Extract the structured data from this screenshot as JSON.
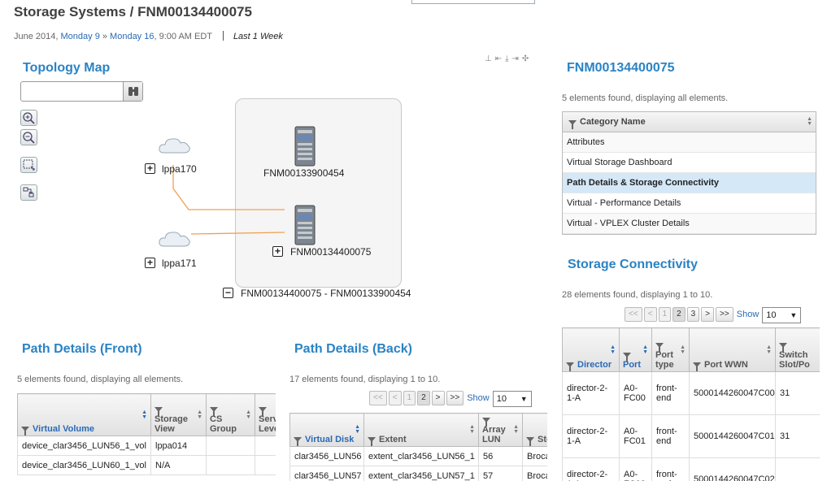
{
  "header": {
    "title": "Storage Systems / FNM00134400075",
    "date_prefix": "June 2014, ",
    "date_from": "Monday 9",
    "date_mid": " » ",
    "date_to": "Monday 16",
    "date_time": ", 9:00 AM EDT",
    "range": "Last 1 Week"
  },
  "topology": {
    "title": "Topology Map",
    "search_placeholder": "",
    "nodes": {
      "host1": "lppa170",
      "host2": "lppa171",
      "storage1": "FNM00133900454",
      "storage2": "FNM00134400075",
      "group": "FNM00134400075 - FNM00133900454"
    },
    "line_color": "#f0a050"
  },
  "categories": {
    "title": "FNM00134400075",
    "found": "5 elements found, displaying all elements.",
    "header": "Category Name",
    "items": [
      "Attributes",
      "Virtual Storage Dashboard",
      "Path Details & Storage Connectivity",
      "Virtual - Performance Details",
      "Virtual - VPLEX Cluster Details"
    ],
    "selected_index": 2
  },
  "connectivity": {
    "title": "Storage Connectivity",
    "found": "28 elements found, displaying 1 to 10.",
    "pager": {
      "first": "<<",
      "prev": "<",
      "pages": [
        "1",
        "2",
        "3"
      ],
      "next": ">",
      "last": ">>",
      "show_label": "Show",
      "show_value": "10"
    },
    "columns": [
      "Director",
      "Port",
      "Port type",
      "Port WWN",
      "Switch Slot/Po"
    ],
    "rows": [
      [
        "director-2-1-A",
        "A0-FC00",
        "front-end",
        "5000144260047C00",
        "31"
      ],
      [
        "director-2-1-A",
        "A0-FC01",
        "front-end",
        "5000144260047C01",
        "31"
      ],
      [
        "director-2-1-A",
        "A0-FC02",
        "front-end",
        "5000144260047C02",
        ""
      ]
    ]
  },
  "front": {
    "title": "Path Details (Front)",
    "found": "5 elements found, displaying all elements.",
    "columns": [
      "Virtual Volume",
      "Storage View",
      "CS Group",
      "Serv Leve"
    ],
    "rows": [
      [
        "device_clar3456_LUN56_1_vol",
        "lppa014",
        "",
        ""
      ],
      [
        "device_clar3456_LUN60_1_vol",
        "N/A",
        "",
        ""
      ]
    ]
  },
  "back": {
    "title": "Path Details (Back)",
    "found": "17 elements found, displaying 1 to 10.",
    "pager": {
      "first": "<<",
      "prev": "<",
      "pages": [
        "1",
        "2"
      ],
      "next": ">",
      "last": ">>",
      "show_label": "Show",
      "show_value": "10"
    },
    "columns": [
      "Virtual Disk",
      "Extent",
      "Array LUN",
      "Stora"
    ],
    "rows": [
      [
        "clar3456_LUN56",
        "extent_clar3456_LUN56_1",
        "56",
        "Broca"
      ],
      [
        "clar3456_LUN57",
        "extent_clar3456_LUN57_1",
        "57",
        "Broca"
      ]
    ]
  },
  "colors": {
    "accent": "#2a83c4",
    "selected_row": "#d5e8f7"
  }
}
